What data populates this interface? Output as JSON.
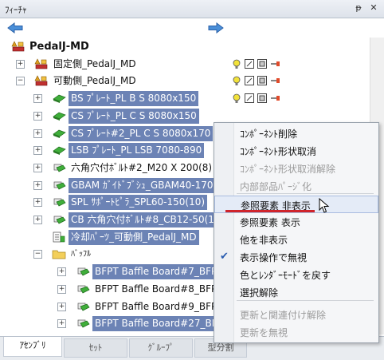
{
  "panel": {
    "title": "ﾌｨｰﾁｬ",
    "pin": "ᵽ",
    "close": "✕"
  },
  "tree": {
    "rows": [
      {
        "label": "PedalJ-MD",
        "indent": 0,
        "icon": "assembly-root-icon",
        "bold": true,
        "sel": false,
        "expander": "",
        "status": false
      },
      {
        "label": "固定側_PedalJ_MD",
        "indent": 1,
        "icon": "subassembly-icon",
        "sel": false,
        "expander": "+",
        "status": true
      },
      {
        "label": "可動側_PedalJ_MD",
        "indent": 1,
        "icon": "subassembly-icon",
        "sel": false,
        "expander": "−",
        "status": true
      },
      {
        "label": "BS ﾌﾟﾚｰﾄ_PL B S 8080x150",
        "indent": 2,
        "icon": "part-green-icon",
        "sel": true,
        "expander": "+",
        "status": true
      },
      {
        "label": "CS ﾌﾟﾚｰﾄ_PL C S 8080x150",
        "indent": 2,
        "icon": "part-green-icon",
        "sel": true,
        "expander": "+",
        "status": false
      },
      {
        "label": "CS ﾌﾟﾚｰﾄ#2_PL C S 8080x170",
        "indent": 2,
        "icon": "part-green-icon",
        "sel": true,
        "expander": "+",
        "status": false
      },
      {
        "label": "LSB ﾌﾟﾚｰﾄ_PL LSB 7080-890",
        "indent": 2,
        "icon": "part-green-icon",
        "sel": true,
        "expander": "+",
        "status": false
      },
      {
        "label": "六角穴付ﾎﾞﾙﾄ#2_M20 X 200(8)",
        "indent": 2,
        "icon": "part-bolt-icon",
        "sel": false,
        "expander": "+",
        "status": false
      },
      {
        "label": "GBAM ｶﾞｲﾄﾞﾌﾞｼｭ_GBAM40-170",
        "indent": 2,
        "icon": "part-bolt-icon",
        "sel": true,
        "expander": "+",
        "status": false
      },
      {
        "label": "SPL ｻﾎﾟｰﾄﾋﾟﾗ_SPL60-150(10)",
        "indent": 2,
        "icon": "part-bolt-icon",
        "sel": true,
        "expander": "+",
        "status": false
      },
      {
        "label": "CB 六角穴付ﾎﾞﾙﾄ#8_CB12-50(1",
        "indent": 2,
        "icon": "part-bolt-icon",
        "sel": true,
        "expander": "+",
        "status": false
      },
      {
        "label": "冷却ﾊﾟｰﾂ_可動側_PedalJ_MD",
        "indent": 2,
        "icon": "cooling-assembly-icon",
        "sel": true,
        "expander": "",
        "status": false
      },
      {
        "label": "ﾊﾞｯﾌﾙ",
        "indent": 2,
        "icon": "folder-icon",
        "sel": false,
        "expander": "−",
        "status": false,
        "small": true
      },
      {
        "label": "BFPT Baffle Board#7_BFP",
        "indent": 3,
        "icon": "part-bolt-icon",
        "sel": true,
        "expander": "+",
        "status": false
      },
      {
        "label": "BFPT Baffle Board#8_BFP",
        "indent": 3,
        "icon": "part-bolt-icon",
        "sel": false,
        "expander": "+",
        "status": false
      },
      {
        "label": "BFPT Baffle Board#9_BFP",
        "indent": 3,
        "icon": "part-bolt-icon",
        "sel": false,
        "expander": "+",
        "status": false
      },
      {
        "label": "BFPT Baffle Board#27_BFP",
        "indent": 3,
        "icon": "part-bolt-icon",
        "sel": true,
        "expander": "+",
        "status": false
      }
    ]
  },
  "context_menu": {
    "items": [
      {
        "label": "ｺﾝﾎﾟｰﾈﾝﾄ削除",
        "disabled": false,
        "checked": false,
        "highlight": false
      },
      {
        "label": "ｺﾝﾎﾟｰﾈﾝﾄ形状取消",
        "disabled": false,
        "checked": false,
        "highlight": false
      },
      {
        "label": "ｺﾝﾎﾟｰﾈﾝﾄ形状取消解除",
        "disabled": true,
        "checked": false,
        "highlight": false
      },
      {
        "label": "内部部品ﾊﾟｰｼﾞ化",
        "disabled": true,
        "checked": false,
        "highlight": false
      },
      {
        "label": "参照要素 非表示",
        "disabled": false,
        "checked": false,
        "highlight": true
      },
      {
        "label": "参照要素 表示",
        "disabled": false,
        "checked": false,
        "highlight": false
      },
      {
        "label": "他を非表示",
        "disabled": false,
        "checked": false,
        "highlight": false
      },
      {
        "label": "表示操作で無視",
        "disabled": false,
        "checked": true,
        "highlight": false
      },
      {
        "label": "色とﾚﾝﾀﾞｰﾓｰﾄﾞを戻す",
        "disabled": false,
        "checked": false,
        "highlight": false
      },
      {
        "label": "選択解除",
        "disabled": false,
        "checked": false,
        "highlight": false
      },
      {
        "label": "更新と関連付け解除",
        "disabled": true,
        "checked": false,
        "highlight": false
      },
      {
        "label": "更新を無視",
        "disabled": true,
        "checked": false,
        "highlight": false
      }
    ]
  },
  "tabs": [
    {
      "label": "ｱｾﾝﾌﾞﾘ",
      "active": true
    },
    {
      "label": "ｾｯﾄ",
      "active": false
    },
    {
      "label": "ｸﾞﾙｰﾌﾟ",
      "active": false
    },
    {
      "label": "型分割",
      "active": false
    }
  ],
  "colors": {
    "selection": "#6c83b5",
    "accent_line": "#d0242b"
  }
}
